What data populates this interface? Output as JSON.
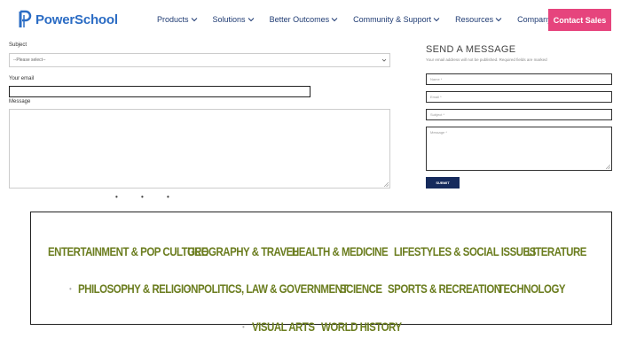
{
  "header": {
    "logo_text": "PowerSchool",
    "nav": [
      "Products",
      "Solutions",
      "Better Outcomes",
      "Community & Support",
      "Resources",
      "Company"
    ],
    "contact_label": "Contact Sales",
    "brand_color": "#2b6cc4",
    "accent_color": "#e6447d"
  },
  "left_form": {
    "subject_label": "Subject",
    "subject_value": "--Please select--",
    "email_label": "Your email",
    "message_label": "Message",
    "dots": "• • •"
  },
  "right_form": {
    "title": "SEND A MESSAGE",
    "note": "Your email address will not be published. Required fields are marked",
    "name_placeholder": "Name *",
    "email_placeholder": "Email *",
    "subject_placeholder": "Subject *",
    "message_placeholder": "Message *",
    "submit_label": "SUBMIT"
  },
  "categories": {
    "separator": "•",
    "items": [
      "ENTERTAINMENT & POP CULTURE",
      "GEOGRAPHY & TRAVEL",
      "HEALTH & MEDICINE",
      "LIFESTYLES & SOCIAL ISSUES",
      "LITERATURE",
      "PHILOSOPHY & RELIGION",
      "POLITICS, LAW & GOVERNMENT",
      "SCIENCE",
      "SPORTS & RECREATION",
      "TECHNOLOGY",
      "VISUAL ARTS",
      "WORLD HISTORY"
    ],
    "text_color": "#6b7d1f"
  }
}
